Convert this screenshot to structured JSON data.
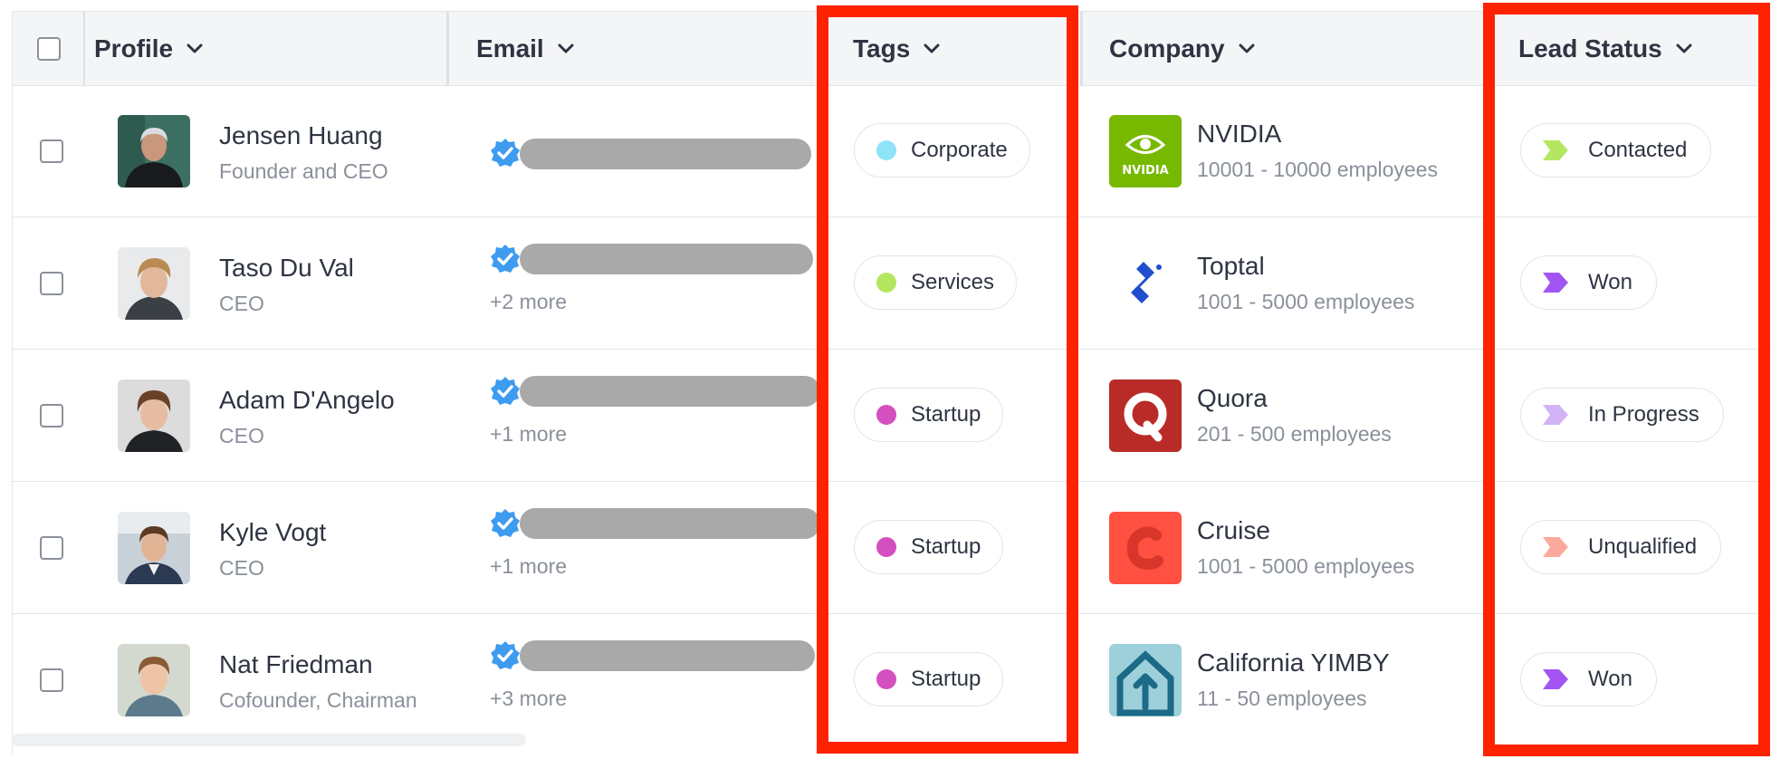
{
  "columns": {
    "profile": "Profile",
    "email": "Email",
    "tags": "Tags",
    "company": "Company",
    "lead_status": "Lead Status"
  },
  "rows": [
    {
      "name": "Jensen Huang",
      "title": "Founder and CEO",
      "more_emails": "",
      "tag": "Corporate",
      "tag_color": "#8fe3f7",
      "company": "NVIDIA",
      "company_size": "10001 - 10000 employees",
      "status": "Contacted",
      "status_color": "#b4e660"
    },
    {
      "name": "Taso Du Val",
      "title": "CEO",
      "more_emails": "+2 more",
      "tag": "Services",
      "tag_color": "#b4e660",
      "company": "Toptal",
      "company_size": "1001 - 5000 employees",
      "status": "Won",
      "status_color": "#a255f2"
    },
    {
      "name": "Adam D'Angelo",
      "title": "CEO",
      "more_emails": "+1 more",
      "tag": "Startup",
      "tag_color": "#d44fbf",
      "company": "Quora",
      "company_size": "201 - 500 employees",
      "status": "In Progress",
      "status_color": "#d2b3f7"
    },
    {
      "name": "Kyle Vogt",
      "title": "CEO",
      "more_emails": "+1 more",
      "tag": "Startup",
      "tag_color": "#d44fbf",
      "company": "Cruise",
      "company_size": "1001 - 5000 employees",
      "status": "Unqualified",
      "status_color": "#fba99c"
    },
    {
      "name": "Nat Friedman",
      "title": "Cofounder, Chairman",
      "more_emails": "+3 more",
      "tag": "Startup",
      "tag_color": "#d44fbf",
      "company": "California YIMBY",
      "company_size": "11 - 50 employees",
      "status": "Won",
      "status_color": "#a255f2"
    }
  ],
  "icons": {
    "sort": "chevron-down-icon",
    "verified": "verified-badge-icon",
    "status": "status-flag-icon"
  },
  "colors": {
    "highlight": "#ff2200",
    "verified": "#3d9bf0"
  }
}
